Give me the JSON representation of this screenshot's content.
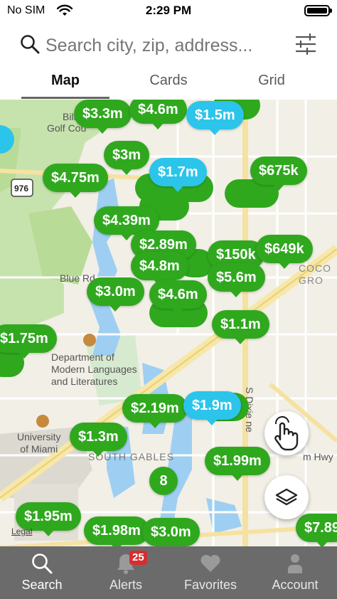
{
  "status_bar": {
    "carrier": "No SIM",
    "time": "2:29 PM"
  },
  "search": {
    "placeholder": "Search city, zip, address..."
  },
  "tabs": [
    {
      "label": "Map",
      "active": true
    },
    {
      "label": "Cards",
      "active": false
    },
    {
      "label": "Grid",
      "active": false
    }
  ],
  "map": {
    "labels": {
      "biltmore": "Biltm",
      "golf": "Golf Cou",
      "blue_rd": "Blue Rd",
      "dept": "Department of\nModern Languages\nand Literatures",
      "university": "University\nof Miami",
      "south_gables": "SOUTH GABLES",
      "highway": "976",
      "coco": "H/\nCOCO\nGRO",
      "hwy": "m Hwy",
      "dune": "S Dixie ne",
      "legal": "Legal"
    },
    "pins": [
      {
        "price": "$3.3m",
        "color": "green"
      },
      {
        "price": "$4.6m",
        "color": "green"
      },
      {
        "price": "$1.5m",
        "color": "blue"
      },
      {
        "price": "$3m",
        "color": "green"
      },
      {
        "price": "$4.75m",
        "color": "green"
      },
      {
        "price": "$1.7m",
        "color": "blue"
      },
      {
        "price": "$675k",
        "color": "green"
      },
      {
        "price": "$4.39m",
        "color": "green"
      },
      {
        "price": "$2.89m",
        "color": "green"
      },
      {
        "price": "$4.8m",
        "color": "green"
      },
      {
        "price": "$150k",
        "color": "green"
      },
      {
        "price": "$649k",
        "color": "green"
      },
      {
        "price": "$5.6m",
        "color": "green"
      },
      {
        "price": "$3.0m",
        "color": "green"
      },
      {
        "price": "$4.6m",
        "color": "green"
      },
      {
        "price": "$1.1m",
        "color": "green"
      },
      {
        "price": "$1.75m",
        "color": "green"
      },
      {
        "price": "$2.19m",
        "color": "green"
      },
      {
        "price": "$1.9m",
        "color": "blue"
      },
      {
        "price": "$1.3m",
        "color": "green"
      },
      {
        "price": "$1.99m",
        "color": "green"
      },
      {
        "price": "8",
        "color": "green"
      },
      {
        "price": "$1.95m",
        "color": "green"
      },
      {
        "price": "$1.98m",
        "color": "green"
      },
      {
        "price": "$3.0m",
        "color": "green"
      },
      {
        "price": "$7.89",
        "color": "green"
      }
    ]
  },
  "bottom_nav": [
    {
      "label": "Search",
      "icon": "search-icon",
      "active": true
    },
    {
      "label": "Alerts",
      "icon": "bell-icon",
      "badge": "25"
    },
    {
      "label": "Favorites",
      "icon": "heart-icon"
    },
    {
      "label": "Account",
      "icon": "person-icon"
    }
  ],
  "colors": {
    "pin_green": "#2fa81e",
    "pin_blue": "#2bc4ea",
    "nav_bg": "#6b6b6b",
    "alert_badge": "#d32f2f"
  }
}
